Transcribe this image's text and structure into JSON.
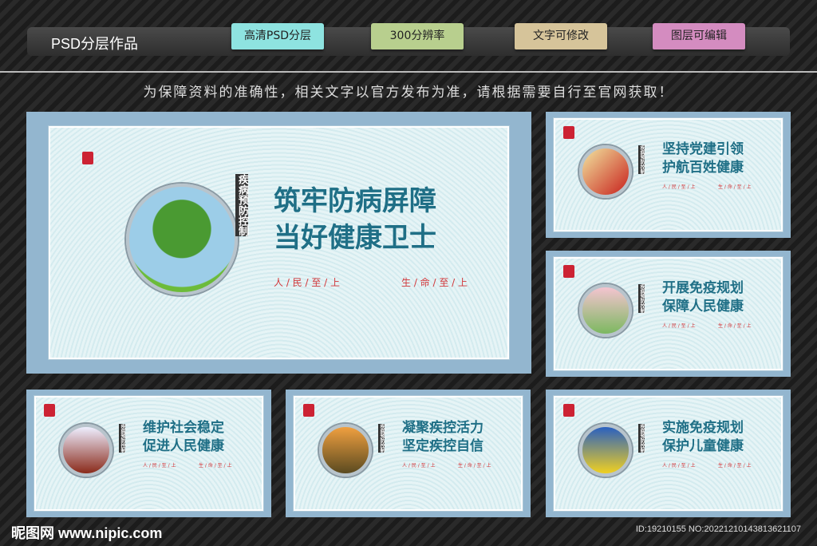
{
  "header": {
    "title": "PSD分层作品",
    "tags": [
      {
        "label": "高清PSD分层",
        "color": "#8ee3e0"
      },
      {
        "label": "300分辨率",
        "color": "#b8cf8e"
      },
      {
        "label": "文字可修改",
        "color": "#d6c49a"
      },
      {
        "label": "图层可编辑",
        "color": "#d48cc0"
      }
    ]
  },
  "notice": "为保障资料的准确性，相关文字以官方发布为准，请根据需要自行至官网获取！",
  "vertical_label": "疾病预防控制",
  "slogan_left": "人 / 民 / 至 / 上",
  "slogan_right": "生 / 命 / 至 / 上",
  "cards": [
    {
      "line1": "筑牢防病屏障",
      "line2": "当好健康卫士"
    },
    {
      "line1": "坚持党建引领",
      "line2": "护航百姓健康"
    },
    {
      "line1": "开展免疫规划",
      "line2": "保障人民健康"
    },
    {
      "line1": "维护社会稳定",
      "line2": "促进人民健康"
    },
    {
      "line1": "凝聚疾控活力",
      "line2": "坚定疾控自信"
    },
    {
      "line1": "实施免疫规划",
      "line2": "保护儿童健康"
    }
  ],
  "footer": {
    "logo": "昵图网 www.nipic.com",
    "id": "ID:19210155 NO:20221210143813621107"
  }
}
